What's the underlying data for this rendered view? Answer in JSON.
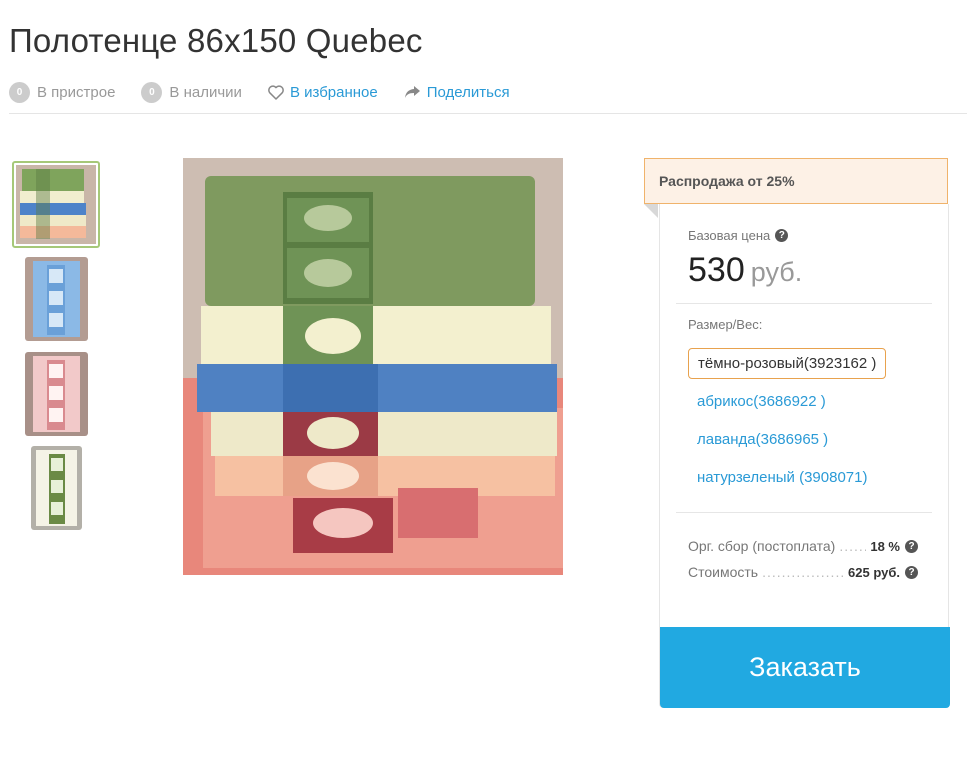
{
  "product": {
    "title": "Полотенце 86х150 Quebec"
  },
  "actions": {
    "pristroy": {
      "count": "0",
      "label": "В пристрое"
    },
    "stock": {
      "count": "0",
      "label": "В наличии"
    },
    "favorite": {
      "label": "В избранное",
      "icon": "heart-icon"
    },
    "share": {
      "label": "Поделиться",
      "icon": "share-icon"
    }
  },
  "gallery": {
    "thumbnails": [
      "green-towel-stack",
      "blue-towel",
      "pink-towel",
      "white-green-towel"
    ],
    "active_index": 0
  },
  "offer": {
    "sale_banner": "Распродажа от 25%",
    "base_price_label": "Базовая цена",
    "base_price_value": "530",
    "currency": "руб.",
    "size_label": "Размер/Вес:",
    "options": [
      {
        "label": "тёмно-розовый(3923162 )",
        "selected": true
      },
      {
        "label": "абрикос(3686922 )",
        "selected": false
      },
      {
        "label": "лаванда(3686965 )",
        "selected": false
      },
      {
        "label": "натурзеленый (3908071)",
        "selected": false
      }
    ],
    "org_fee_label": "Орг. сбор (постоплата)",
    "org_fee_value": "18 %",
    "cost_label": "Стоимость",
    "cost_value": "625 руб.",
    "order_button": "Заказать"
  },
  "colors": {
    "link": "#2a9ad6",
    "order_button": "#21a9e1",
    "selected_border": "#e8a24e",
    "sale_bg": "#fdf1e6"
  }
}
